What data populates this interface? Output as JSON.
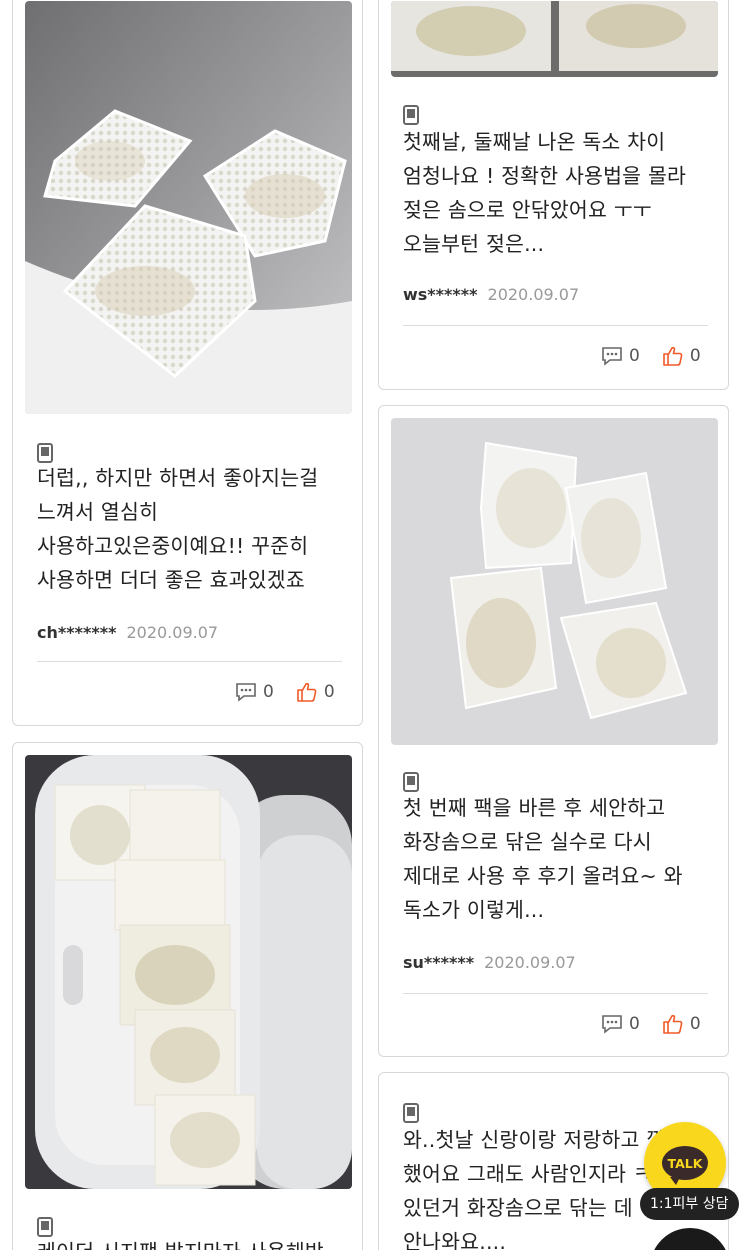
{
  "reviews": [
    {
      "text": "더럽,, 하지만 하면서 좋아지는걸 느껴서 열심히 사용하고있은중이예요!! 꾸준히 사용하면 더더 좋은 효과있겠죠",
      "user": "ch*******",
      "date": "2020.09.07",
      "comments": "0",
      "likes": "0"
    },
    {
      "text": "첫째날, 둘째날 나온 독소 차이 엄청나요 ! 정확한 사용법을 몰라 젖은 솜으로 안닦았어요 ㅜㅜ 오늘부턴 젖은...",
      "user": "ws******",
      "date": "2020.09.07",
      "comments": "0",
      "likes": "0"
    },
    {
      "text": "첫 번째 팩을 바른 후 세안하고 화장솜으로 닦은 실수로 다시 제대로 사용 후 후기 올려요~ 와 독소가 이렇게...",
      "user": "su******",
      "date": "2020.09.07",
      "comments": "0",
      "likes": "0"
    },
    {
      "text": "와..첫날 신랑이랑 저랑하고 깜짝 했어요 그래도 사람인지라 ㅋ 쉬에 있던거 화장솜으로 닦는 데 안나와요....",
      "user": "",
      "date": "",
      "comments": "",
      "likes": ""
    },
    {
      "text": "레이더 시지팩 발지마자 사용해밨",
      "user": "",
      "date": "",
      "comments": "",
      "likes": ""
    }
  ],
  "widget": {
    "talk_label": "TALK",
    "consult_label": "1:1피부 상담"
  },
  "colors": {
    "talk_yellow": "#f9d71c",
    "like_orange": "#f05a28",
    "border": "#d8d8d8"
  }
}
